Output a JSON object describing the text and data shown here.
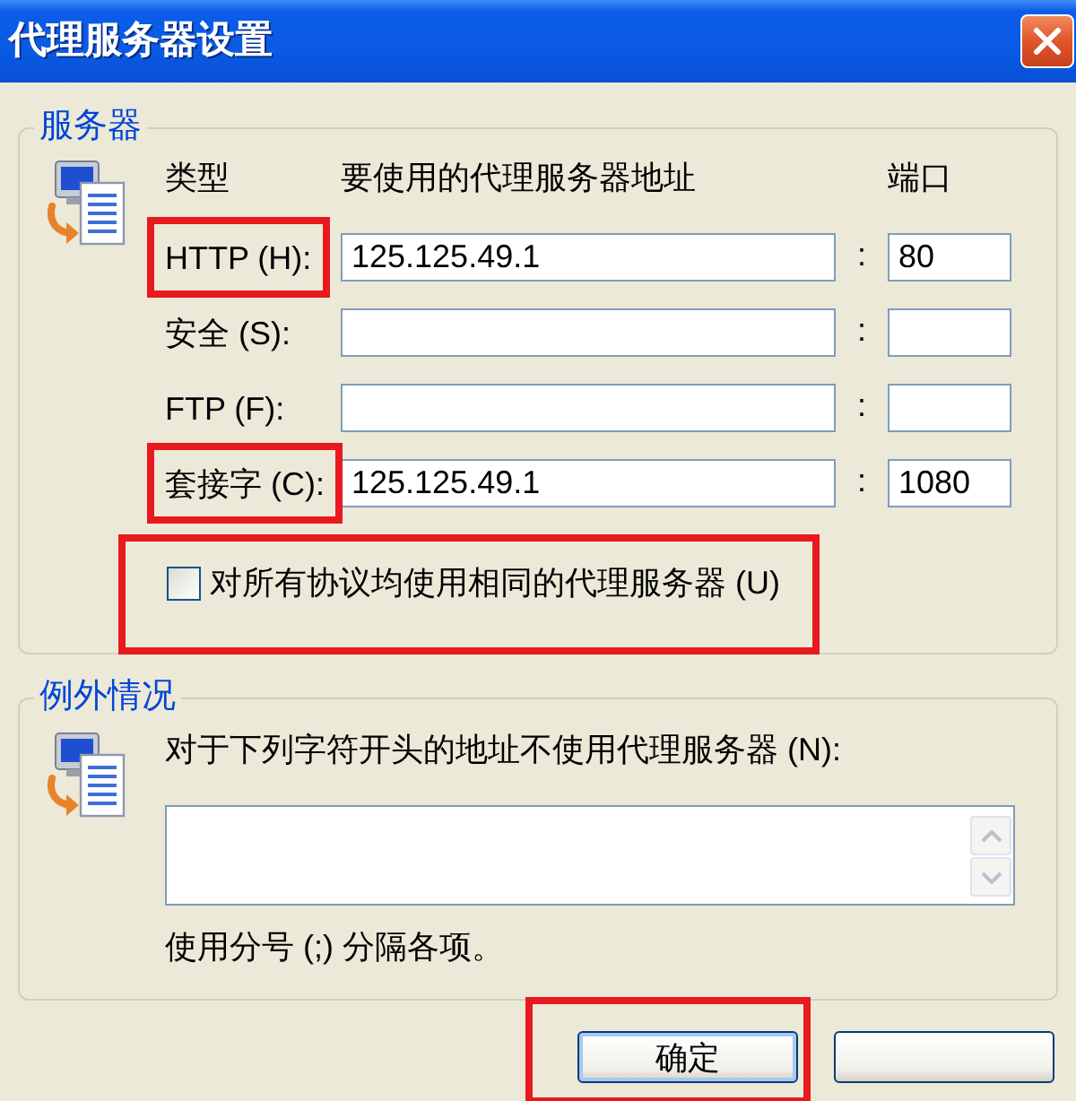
{
  "window": {
    "title": "代理服务器设置"
  },
  "servers": {
    "legend": "服务器",
    "headers": {
      "type": "类型",
      "address": "要使用的代理服务器地址",
      "port": "端口"
    },
    "proxies": [
      {
        "label": "HTTP (H):",
        "address": "125.125.49.1",
        "separator": ":",
        "port": "80",
        "highlighted": true
      },
      {
        "label": "安全 (S):",
        "separator": ":",
        "highlighted": false
      },
      {
        "label": "FTP (F):",
        "separator": ":",
        "highlighted": false
      },
      {
        "label": "套接字 (C):",
        "address": "125.125.49.1",
        "separator": ":",
        "port": "1080",
        "highlighted": true
      }
    ],
    "same_proxy": {
      "label": "对所有协议均使用相同的代理服务器 (U)",
      "checked": false,
      "highlighted": true
    }
  },
  "exceptions": {
    "legend": "例外情况",
    "prompt": "对于下列字符开头的地址不使用代理服务器 (N):",
    "hint": "使用分号 (;) 分隔各项。"
  },
  "buttons": [
    {
      "label": "确定",
      "highlighted": true
    },
    {
      "highlighted": false
    }
  ]
}
